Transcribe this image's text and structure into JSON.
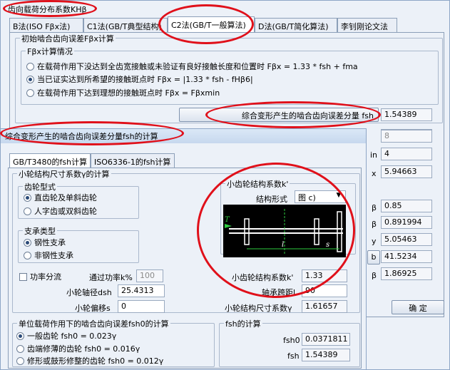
{
  "back_window": {
    "title": "齿向载荷分布系数KHβ",
    "tabs": [
      "B法(ISO Fβx法)",
      "C1法(GB/T典型结构)",
      "C2法(GB/T一般算法)",
      "D法(GB/T简化算法)",
      "李钊刚论文法"
    ],
    "group_title": "初始啮合齿向误差Fβx计算",
    "sub_title": "Fβx计算情况",
    "options": [
      "在载荷作用下没达到全齿宽接触或未验证有良好接触长度和位置时   Fβx = 1.33 * fsh + fma",
      "当已证实达到所希望的接触斑点时   Fβx = |1.33 * fsh - fHβ6|",
      "在载荷作用下达到理想的接触斑点时   Fβx = Fβxmin"
    ],
    "fsh_button": "综合变形产生的啮合齿向误差分量 fsh",
    "fsh_value": "1.54389",
    "side_values": [
      "",
      "8",
      "",
      "4",
      "5.94663",
      "",
      "0.85",
      "0.891994",
      "5.05463",
      "41.5234",
      "1.86925"
    ],
    "side_labels": [
      "in",
      "x",
      "β",
      "β",
      "y",
      "b",
      "β"
    ],
    "ok_button": "确  定"
  },
  "front_window": {
    "title": "综合变形产生的啮合齿向误差分量fsh的计算",
    "tabs": [
      "GB/T3480的fsh计算",
      "ISO6336-1的fsh计算"
    ],
    "gamma_group": "小轮结构尺寸系数γ的计算",
    "gear_type_title": "齿轮型式",
    "gear_types": [
      "直齿轮及单斜齿轮",
      "人字齿或双斜齿轮"
    ],
    "support_title": "支承类型",
    "supports": [
      "钢性支承",
      "非钢性支承"
    ],
    "power_split": "功率分流",
    "power_pct_label": "通过功率k%",
    "power_pct_value": "100",
    "dsh_label": "小轮轴径dsh",
    "dsh_value": "25.4313",
    "offset_label": "小轮偏移s",
    "offset_value": "0",
    "kprime_group": "小齿轮结构系数k'",
    "struct_form_label": "结构形式",
    "struct_form_value": "图 c)",
    "kprime_label": "小齿轮结构系数k'",
    "kprime_value": "1.33",
    "span_label": "轴承跨距l",
    "span_value": "90",
    "gamma_label": "小轮结构尺寸系数γ",
    "gamma_value": "1.61657",
    "fsh0_group": "单位载荷作用下的啮合齿向误差fsh0的计算",
    "fsh0_options": [
      "一般齿轮   fsh0 = 0.023γ",
      "齿端修薄的齿轮   fsh0 = 0.016γ",
      "修形或鼓形修整的齿轮   fsh0 = 0.012γ"
    ],
    "fsh_group": "fsh的计算",
    "fsh0_label": "fsh0",
    "fsh0_value": "0.0371811",
    "fsh_label": "fsh",
    "fsh_value": "1.54389"
  },
  "diagram": {
    "force_label": "T",
    "l_label": "l",
    "s_label": "s"
  },
  "colors": {
    "annotation": "#e0101a",
    "background": "#cfe0f3"
  }
}
